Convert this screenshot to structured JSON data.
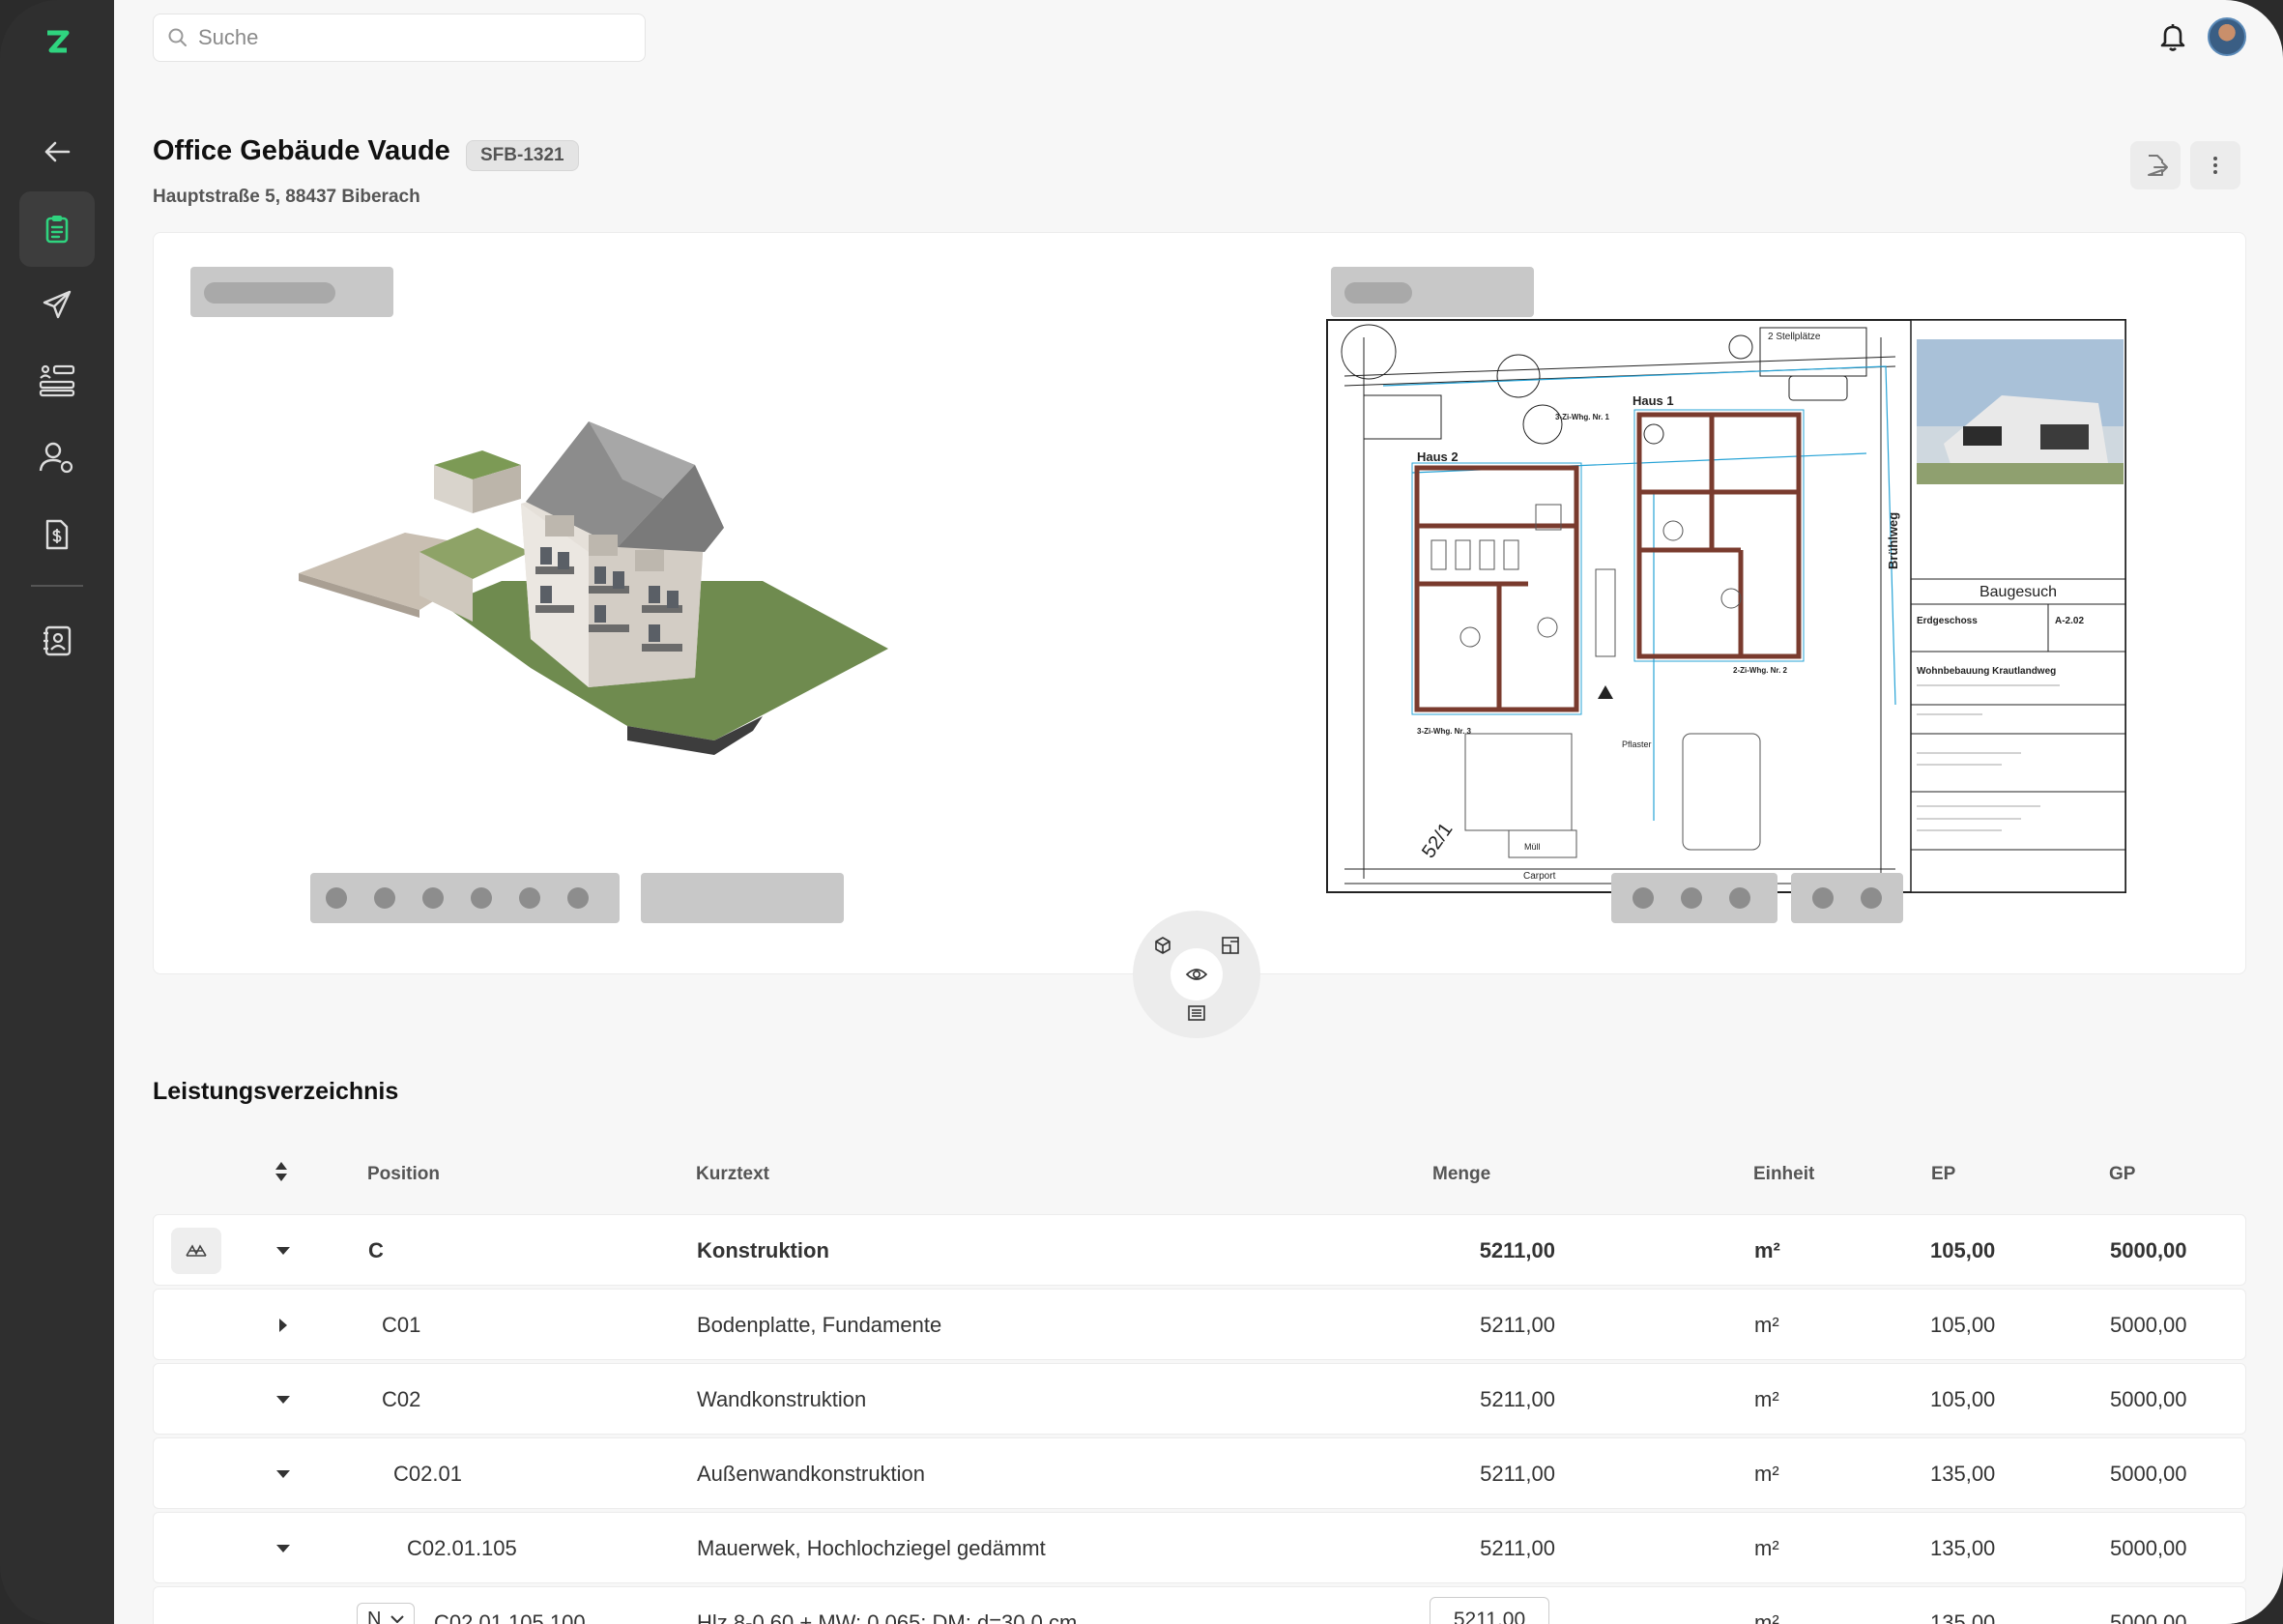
{
  "app": {
    "logo_letter": "Z",
    "accent": "#2fd47f"
  },
  "sidebar": {
    "items": [
      {
        "icon": "back-arrow-icon"
      },
      {
        "icon": "clipboard-icon",
        "active": true
      },
      {
        "icon": "paper-plane-icon"
      },
      {
        "icon": "task-list-icon"
      },
      {
        "icon": "user-settings-icon"
      },
      {
        "icon": "invoice-icon"
      },
      {
        "icon": "contact-card-icon"
      }
    ]
  },
  "search": {
    "placeholder": "Suche"
  },
  "project": {
    "title": "Office Gebäude Vaude",
    "code": "SFB-1321",
    "address": "Hauptstraße 5, 88437 Biberach"
  },
  "plan": {
    "labels": [
      "Haus 1",
      "Haus 2",
      "Brühlweg",
      "2 Stellplätze",
      "Baugesuch",
      "Erdgeschoss",
      "A-2.02",
      "Wohnbebauung Krautlandweg",
      "3-Zi-Whg. Nr. 1",
      "2-Zi-Whg. Nr. 2",
      "3-Zi-Whg. Nr. 3",
      "Pflaster",
      "Müll",
      "Carport",
      "52/1"
    ]
  },
  "table": {
    "title": "Leistungsverzeichnis",
    "headers": {
      "position": "Position",
      "kurztext": "Kurztext",
      "menge": "Menge",
      "einheit": "Einheit",
      "ep": "EP",
      "gp": "GP"
    },
    "rows": [
      {
        "position": "C",
        "kurztext": "Konstruktion",
        "menge": "5211,00",
        "einheit": "m²",
        "ep": "105,00",
        "gp": "5000,00",
        "bold": true
      },
      {
        "position": "C01",
        "kurztext": "Bodenplatte, Fundamente",
        "menge": "5211,00",
        "einheit": "m²",
        "ep": "105,00",
        "gp": "5000,00"
      },
      {
        "position": "C02",
        "kurztext": "Wandkonstruktion",
        "menge": "5211,00",
        "einheit": "m²",
        "ep": "105,00",
        "gp": "5000,00"
      },
      {
        "position": "C02.01",
        "kurztext": "Außenwandkonstruktion",
        "menge": "5211,00",
        "einheit": "m²",
        "ep": "135,00",
        "gp": "5000,00"
      },
      {
        "position": "C02.01.105",
        "kurztext": "Mauerwek, Hochlochziegel gedämmt",
        "menge": "5211,00",
        "einheit": "m²",
        "ep": "135,00",
        "gp": "5000,00"
      },
      {
        "tag": "N",
        "position": "C02.01.105.100",
        "kurztext": "Hlz 8-0,60 + MW; 0,065; DM; d=30,0 cm",
        "menge": "5211,00",
        "einheit": "m²",
        "ep": "135,00",
        "gp": "5000,00"
      }
    ]
  }
}
